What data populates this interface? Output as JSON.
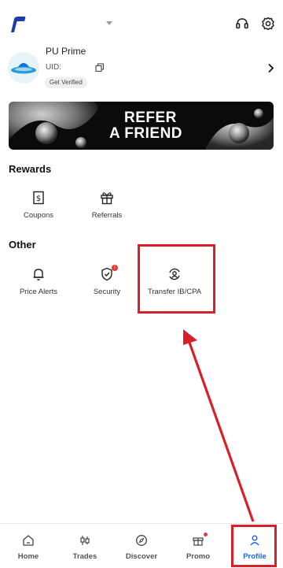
{
  "header": {
    "logo_icon": "pu-prime-logo-icon",
    "dropdown_icon": "caret-down-icon",
    "support_icon": "headset-icon",
    "settings_icon": "gear-icon"
  },
  "profile": {
    "name": "PU Prime",
    "uid_label": "UID:",
    "verify_label": "Get Verified",
    "avatar_icon": "ufo-avatar-icon"
  },
  "banner": {
    "line1": "REFER",
    "line2": "A FRIEND"
  },
  "rewards": {
    "title": "Rewards",
    "items": [
      {
        "label": "Coupons",
        "icon": "coupon-icon"
      },
      {
        "label": "Referrals",
        "icon": "gift-icon"
      }
    ]
  },
  "other": {
    "title": "Other",
    "items": [
      {
        "label": "Price Alerts",
        "icon": "bell-icon"
      },
      {
        "label": "Security",
        "icon": "shield-icon",
        "badge": "!"
      },
      {
        "label": "Transfer IB/CPA",
        "icon": "transfer-user-icon"
      }
    ]
  },
  "bottom_nav": {
    "items": [
      {
        "label": "Home",
        "icon": "home-icon"
      },
      {
        "label": "Trades",
        "icon": "candlestick-icon"
      },
      {
        "label": "Discover",
        "icon": "compass-icon"
      },
      {
        "label": "Promo",
        "icon": "gift-icon"
      },
      {
        "label": "Profile",
        "icon": "user-icon"
      }
    ],
    "active": "Profile"
  },
  "colors": {
    "accent": "#1c64d8",
    "annotation": "#d8202a",
    "badge": "#e53a3a"
  }
}
